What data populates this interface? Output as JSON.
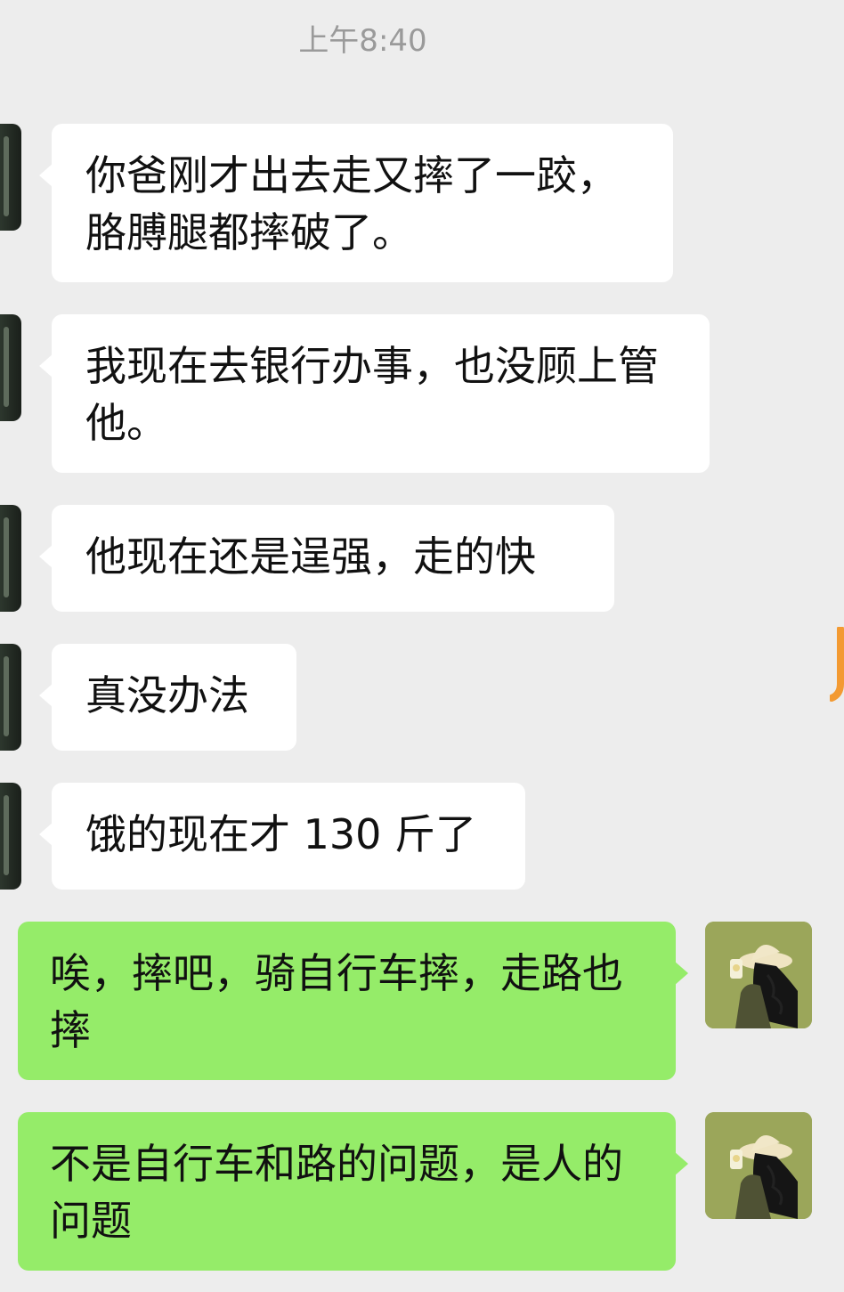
{
  "chat": {
    "timestamp": "上午8:40",
    "messages": [
      {
        "sender": "contact",
        "text": "你爸刚才出去走又摔了一跤，胳膊腿都摔破了。"
      },
      {
        "sender": "contact",
        "text": "我现在去银行办事，也没顾上管他。"
      },
      {
        "sender": "contact",
        "text": "他现在还是逞强，走的快"
      },
      {
        "sender": "contact",
        "text": "真没办法"
      },
      {
        "sender": "contact",
        "text": "饿的现在才 130 斤了"
      },
      {
        "sender": "me",
        "text": "唉，摔吧，骑自行车摔，走路也摔"
      },
      {
        "sender": "me",
        "text": "不是自行车和路的问题，是人的问题"
      }
    ]
  },
  "icons": {
    "contact_avatar": "contact-avatar-image",
    "my_avatar": "woman-in-hat-avatar",
    "side_handle": "floating-sidebar-handle-icon"
  },
  "colors": {
    "background": "#ededed",
    "incoming_bubble": "#ffffff",
    "outgoing_bubble": "#95ec69",
    "timestamp_text": "#9a9a9a",
    "side_handle": "#f39a32"
  }
}
